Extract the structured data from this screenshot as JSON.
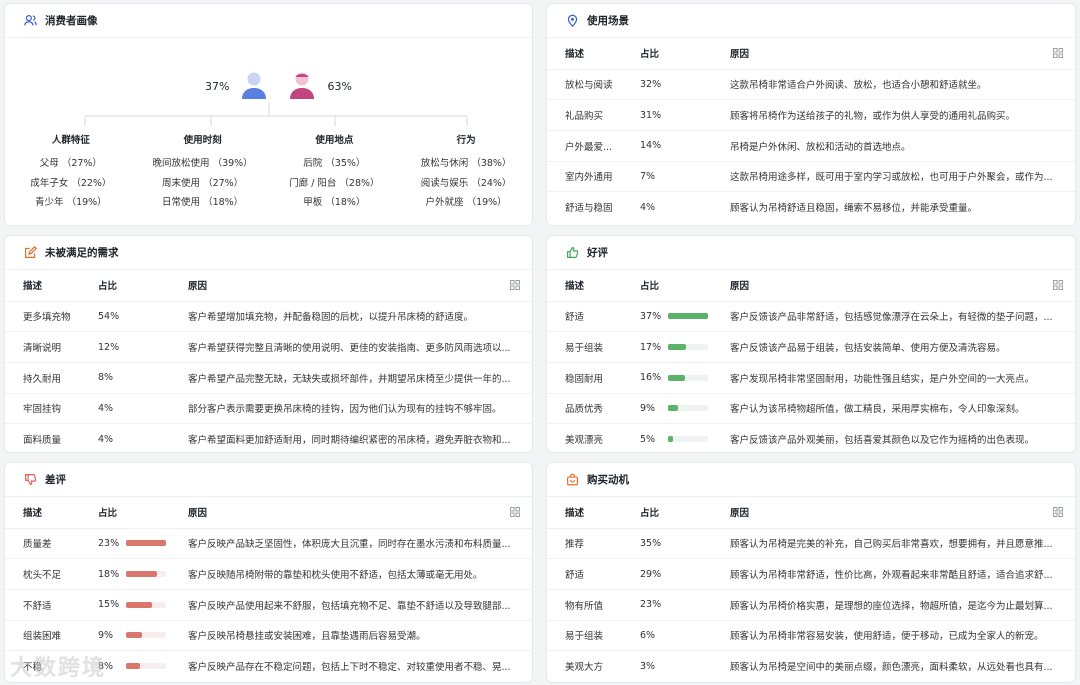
{
  "persona": {
    "title": "消费者画像",
    "male_pct": "37%",
    "female_pct": "63%",
    "columns": [
      {
        "title": "人群特征",
        "items": [
          "父母 （27%）",
          "成年子女 （22%）",
          "青少年 （19%）"
        ]
      },
      {
        "title": "使用时刻",
        "items": [
          "晚间放松使用 （39%）",
          "周末使用 （27%）",
          "日常使用 （18%）"
        ]
      },
      {
        "title": "使用地点",
        "items": [
          "后院 （35%）",
          "门廊 / 阳台 （28%）",
          "甲板 （18%）"
        ]
      },
      {
        "title": "行为",
        "items": [
          "放松与休闲 （38%）",
          "阅读与娱乐 （24%）",
          "户外就座 （19%）"
        ]
      }
    ]
  },
  "scenes": {
    "title": "使用场景",
    "headers": [
      "描述",
      "占比",
      "原因"
    ],
    "rows": [
      {
        "desc": "放松与阅读",
        "pct": "32%",
        "reason": "这款吊椅非常适合户外阅读、放松，也适合小憩和舒适就坐。"
      },
      {
        "desc": "礼品购买",
        "pct": "31%",
        "reason": "顾客将吊椅作为送给孩子的礼物，或作为供人享受的通用礼品购买。"
      },
      {
        "desc": "户外最爱...",
        "pct": "14%",
        "reason": "吊椅是户外休闲、放松和活动的首选地点。"
      },
      {
        "desc": "室内外通用",
        "pct": "7%",
        "reason": "这款吊椅用途多样，既可用于室内学习或放松，也可用于户外聚会，或作为..."
      },
      {
        "desc": "舒适与稳固",
        "pct": "4%",
        "reason": "顾客认为吊椅舒适且稳固，绳索不易移位，并能承受重量。"
      }
    ]
  },
  "unmet": {
    "title": "未被满足的需求",
    "headers": [
      "描述",
      "占比",
      "原因"
    ],
    "rows": [
      {
        "desc": "更多填充物",
        "pct": "54%",
        "reason": "客户希望增加填充物，并配备稳固的后枕，以提升吊床椅的舒适度。"
      },
      {
        "desc": "清晰说明",
        "pct": "12%",
        "reason": "客户希望获得完整且清晰的使用说明、更佳的安装指南、更多防风雨选项以..."
      },
      {
        "desc": "持久耐用",
        "pct": "8%",
        "reason": "客户希望产品完整无缺，无缺失或损坏部件，并期望吊床椅至少提供一年的..."
      },
      {
        "desc": "牢固挂钩",
        "pct": "4%",
        "reason": "部分客户表示需要更换吊床椅的挂钩，因为他们认为现有的挂钩不够牢固。"
      },
      {
        "desc": "面料质量",
        "pct": "4%",
        "reason": "客户希望面料更加舒适耐用，同时期待编织紧密的吊床椅，避免弄脏衣物和..."
      }
    ]
  },
  "positive": {
    "title": "好评",
    "headers": [
      "描述",
      "占比",
      "原因"
    ],
    "bar_color": "#5bb26a",
    "rows": [
      {
        "desc": "舒适",
        "pct": "37%",
        "level": 37,
        "reason": "客户反馈该产品非常舒适，包括感觉像漂浮在云朵上，有轻微的垫子问题，..."
      },
      {
        "desc": "易于组装",
        "pct": "17%",
        "level": 17,
        "reason": "客户反馈该产品易于组装，包括安装简单、使用方便及清洗容易。"
      },
      {
        "desc": "稳固耐用",
        "pct": "16%",
        "level": 16,
        "reason": "客户发现吊椅非常坚固耐用，功能性强且结实，是户外空间的一大亮点。"
      },
      {
        "desc": "品质优秀",
        "pct": "9%",
        "level": 9,
        "reason": "客户认为该吊椅物超所值，做工精良，采用厚实棉布，令人印象深刻。"
      },
      {
        "desc": "美观漂亮",
        "pct": "5%",
        "level": 5,
        "reason": "客户反馈该产品外观美丽，包括喜爱其颜色以及它作为摇椅的出色表现。"
      }
    ]
  },
  "negative": {
    "title": "差评",
    "headers": [
      "描述",
      "占比",
      "原因"
    ],
    "bar_color": "#d9776c",
    "rows": [
      {
        "desc": "质量差",
        "pct": "23%",
        "level": 23,
        "reason": "客户反映产品缺乏坚固性，体积庞大且沉重，同时存在墨水污渍和布料质量..."
      },
      {
        "desc": "枕头不足",
        "pct": "18%",
        "level": 18,
        "reason": "客户反映随吊椅附带的靠垫和枕头使用不舒适，包括太薄或毫无用处。"
      },
      {
        "desc": "不舒适",
        "pct": "15%",
        "level": 15,
        "reason": "客户反映产品使用起来不舒服，包括填充物不足、靠垫不舒适以及导致腿部..."
      },
      {
        "desc": "组装困难",
        "pct": "9%",
        "level": 9,
        "reason": "客户反映吊椅悬挂或安装困难，且靠垫遇雨后容易受潮。"
      },
      {
        "desc": "不稳",
        "pct": "8%",
        "level": 8,
        "reason": "客户反映产品存在不稳定问题，包括上下时不稳定、对较重使用者不稳、晃..."
      }
    ]
  },
  "motive": {
    "title": "购买动机",
    "headers": [
      "描述",
      "占比",
      "原因"
    ],
    "rows": [
      {
        "desc": "推荐",
        "pct": "35%",
        "reason": "顾客认为吊椅是完美的补充，自己购买后非常喜欢，想要拥有，并且愿意推..."
      },
      {
        "desc": "舒适",
        "pct": "29%",
        "reason": "顾客认为吊椅非常舒适，性价比高，外观看起来非常酷且舒适，适合追求舒..."
      },
      {
        "desc": "物有所值",
        "pct": "23%",
        "reason": "顾客认为吊椅价格实惠，是理想的座位选择，物超所值，是迄今为止最划算..."
      },
      {
        "desc": "易于组装",
        "pct": "6%",
        "reason": "顾客认为吊椅非常容易安装，使用舒适，便于移动，已成为全家人的新宠。"
      },
      {
        "desc": "美观大方",
        "pct": "3%",
        "reason": "顾客认为吊椅是空间中的美丽点缀，颜色漂亮，面料柔软，从远处看也具有..."
      }
    ]
  },
  "watermark": "大数跨境",
  "colors": {
    "male": "#5b7fe0",
    "female": "#c2467e",
    "icon_blue": "#3b5bdb",
    "icon_orange": "#e8702a",
    "icon_green": "#3aa655",
    "icon_red": "#e05a4f"
  }
}
